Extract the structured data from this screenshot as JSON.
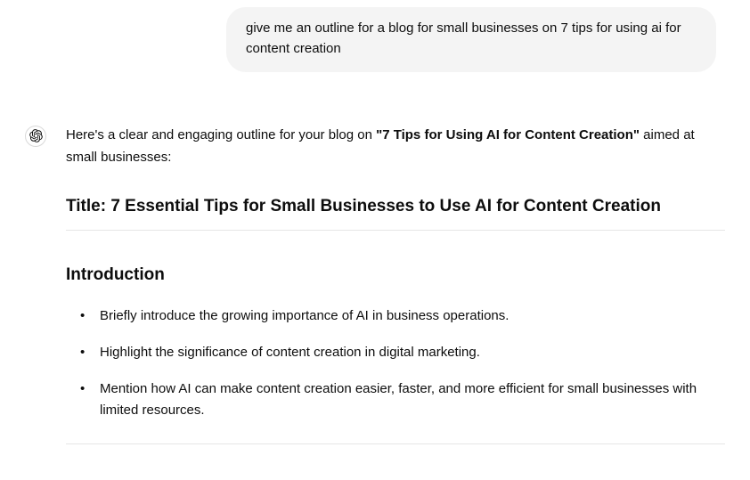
{
  "user_message": "give me an outline for a blog for small businesses on 7 tips for using ai for content creation",
  "assistant": {
    "lead_prefix": "Here's a clear and engaging outline for your blog on ",
    "lead_quoted": "\"7 Tips for Using AI for Content Creation\"",
    "lead_suffix": " aimed at small businesses:",
    "title_label": "Title: ",
    "title_value": "7 Essential Tips for Small Businesses to Use AI for Content Creation",
    "intro_heading": "Introduction",
    "intro_bullets": [
      "Briefly introduce the growing importance of AI in business operations.",
      "Highlight the significance of content creation in digital marketing.",
      "Mention how AI can make content creation easier, faster, and more efficient for small businesses with limited resources."
    ]
  }
}
